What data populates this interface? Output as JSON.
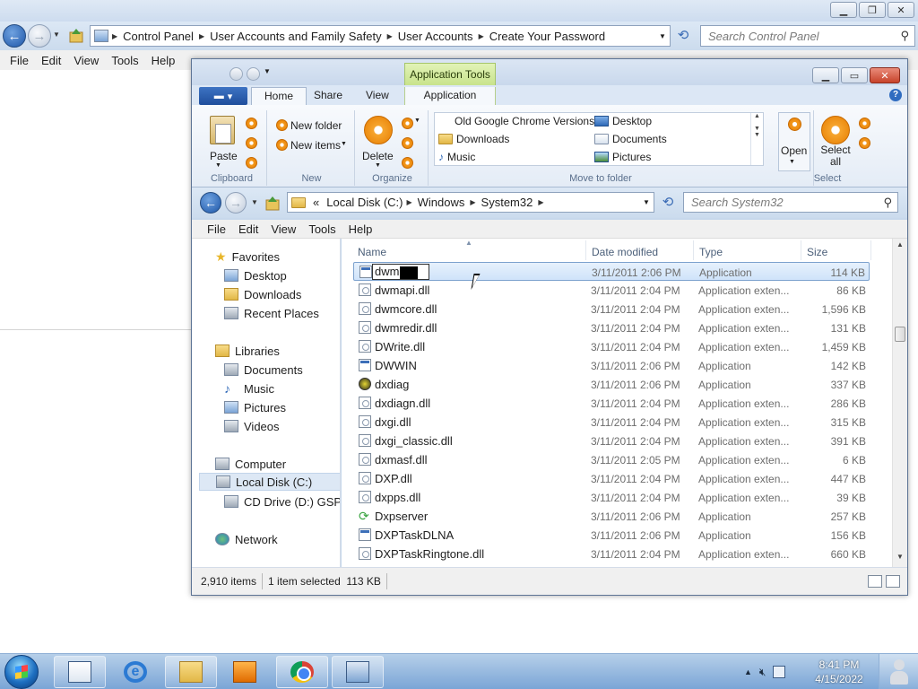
{
  "control_panel": {
    "breadcrumbs": [
      "Control Panel",
      "User Accounts and Family Safety",
      "User Accounts",
      "Create Your Password"
    ],
    "search_placeholder": "Search Control Panel",
    "menu": [
      "File",
      "Edit",
      "View",
      "Tools",
      "Help"
    ]
  },
  "explorer": {
    "contextual_tab": "Application Tools",
    "tabs": [
      "Home",
      "Share",
      "View",
      "Application"
    ],
    "ribbon": {
      "paste": "Paste",
      "clipboard": "Clipboard",
      "new_folder": "New folder",
      "new_items": "New items",
      "new_group": "New",
      "delete": "Delete",
      "organize": "Organize",
      "move_items": [
        "Old Google Chrome Versions",
        "Downloads",
        "Music",
        "Desktop",
        "Documents",
        "Pictures"
      ],
      "move_to_folder": "Move to folder",
      "open": "Open",
      "select_all": "Select all",
      "select": "Select"
    },
    "address": [
      "«",
      "Local Disk (C:)",
      "Windows",
      "System32"
    ],
    "search_placeholder": "Search System32",
    "menu": [
      "File",
      "Edit",
      "View",
      "Tools",
      "Help"
    ],
    "nav": {
      "favorites": "Favorites",
      "desktop": "Desktop",
      "downloads": "Downloads",
      "recent": "Recent Places",
      "libraries": "Libraries",
      "documents": "Documents",
      "music": "Music",
      "pictures": "Pictures",
      "videos": "Videos",
      "computer": "Computer",
      "local_disk": "Local Disk (C:)",
      "cd_drive": "CD Drive (D:) GSP1",
      "network": "Network"
    },
    "columns": {
      "name": "Name",
      "date": "Date modified",
      "type": "Type",
      "size": "Size"
    },
    "rename_value": "dwm",
    "rows": [
      {
        "name": "dwm",
        "date": "3/11/2011 2:06 PM",
        "type": "Application",
        "size": "114 KB",
        "icon": "app-icon"
      },
      {
        "name": "dwmapi.dll",
        "date": "3/11/2011 2:04 PM",
        "type": "Application exten...",
        "size": "86 KB",
        "icon": "dll-icon"
      },
      {
        "name": "dwmcore.dll",
        "date": "3/11/2011 2:04 PM",
        "type": "Application exten...",
        "size": "1,596 KB",
        "icon": "dll-icon"
      },
      {
        "name": "dwmredir.dll",
        "date": "3/11/2011 2:04 PM",
        "type": "Application exten...",
        "size": "131 KB",
        "icon": "dll-icon"
      },
      {
        "name": "DWrite.dll",
        "date": "3/11/2011 2:04 PM",
        "type": "Application exten...",
        "size": "1,459 KB",
        "icon": "dll-icon"
      },
      {
        "name": "DWWIN",
        "date": "3/11/2011 2:06 PM",
        "type": "Application",
        "size": "142 KB",
        "icon": "app-icon"
      },
      {
        "name": "dxdiag",
        "date": "3/11/2011 2:06 PM",
        "type": "Application",
        "size": "337 KB",
        "icon": "dxdiag-icon"
      },
      {
        "name": "dxdiagn.dll",
        "date": "3/11/2011 2:04 PM",
        "type": "Application exten...",
        "size": "286 KB",
        "icon": "dll-icon"
      },
      {
        "name": "dxgi.dll",
        "date": "3/11/2011 2:04 PM",
        "type": "Application exten...",
        "size": "315 KB",
        "icon": "dll-icon"
      },
      {
        "name": "dxgi_classic.dll",
        "date": "3/11/2011 2:04 PM",
        "type": "Application exten...",
        "size": "391 KB",
        "icon": "dll-icon"
      },
      {
        "name": "dxmasf.dll",
        "date": "3/11/2011 2:05 PM",
        "type": "Application exten...",
        "size": "6 KB",
        "icon": "dll-icon"
      },
      {
        "name": "DXP.dll",
        "date": "3/11/2011 2:04 PM",
        "type": "Application exten...",
        "size": "447 KB",
        "icon": "dll-icon"
      },
      {
        "name": "dxpps.dll",
        "date": "3/11/2011 2:04 PM",
        "type": "Application exten...",
        "size": "39 KB",
        "icon": "dll-icon"
      },
      {
        "name": "Dxpserver",
        "date": "3/11/2011 2:06 PM",
        "type": "Application",
        "size": "257 KB",
        "icon": "dxpserver-icon"
      },
      {
        "name": "DXPTaskDLNA",
        "date": "3/11/2011 2:06 PM",
        "type": "Application",
        "size": "156 KB",
        "icon": "app-icon"
      },
      {
        "name": "DXPTaskRingtone.dll",
        "date": "3/11/2011 2:04 PM",
        "type": "Application exten...",
        "size": "660 KB",
        "icon": "dll-icon"
      }
    ],
    "status": {
      "items": "2,910 items",
      "selected": "1 item selected  113 KB"
    }
  },
  "taskbar": {
    "time": "8:41 PM",
    "date": "4/15/2022",
    "apps": [
      "task-list-icon",
      "internet-explorer-icon",
      "file-explorer-icon",
      "media-player-icon",
      "chrome-icon",
      "control-panel-icon"
    ]
  }
}
